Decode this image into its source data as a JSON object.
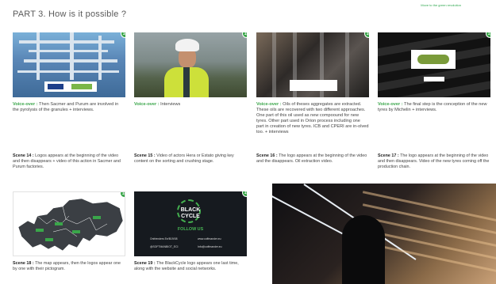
{
  "page": {
    "title": "PART 3. How is it possible ?",
    "brand_tag": "Move to the green revolution"
  },
  "voice_label": "Voice-over :",
  "cards": [
    {
      "badge": "14",
      "voice_text": " Then Sacmer and Purum are involved in the pyrolysis of the granules + interviews.",
      "scene_label": "Scene 14 :",
      "scene_text": " Logos appears at the beginning of the video and then disappears + video of this action in Sacmer and Purum factories."
    },
    {
      "badge": "15",
      "voice_text": " Interviews",
      "scene_label": "Scene 15 :",
      "scene_text": " Video of actors Hera or Estato giving key content on the sorting and crushing stage."
    },
    {
      "badge": "16",
      "voice_text": " Oils of theses aggregates are extracted. These oils are recovered with two different approaches. One part of this oil used as new compoound for new tyres. Other part used in Orion process including one part in creation of new tyres. ICB and CPERI are in-olved too. + interviews",
      "scene_label": "Scene 16 :",
      "scene_text": " The logo appears at the beginning of the video and the disappears. Oil extraction video."
    },
    {
      "badge": "17",
      "voice_text": " The final step is the conception of the new tyres by Michelin + interviews.",
      "scene_label": "Scene 17 :",
      "scene_text": " The logo appears at the beginning of the video and then disappears. Video of the new tyres coming off the production chain."
    },
    {
      "badge": "18",
      "scene_label": "Scene 18 :",
      "scene_text": " The map appears, then the logos appear one by one with their pictogram."
    },
    {
      "badge": "19",
      "scene_label": "Scene 19 :",
      "scene_text": " The BlackCycle logo appears one last time, along with the website and social networks.",
      "logo_line1": "BLACK",
      "logo_line2": "CYCLE",
      "follow": "FOLLOW US",
      "social": [
        "Onfrienders Ee/B19/08",
        "www.coffmander.eu",
        "@SOFTMANBIOT_ECI",
        "Info@coffmander.eu"
      ]
    }
  ],
  "colors": {
    "accent_green": "#3aa64a",
    "title_grey": "#5a5a5a"
  }
}
